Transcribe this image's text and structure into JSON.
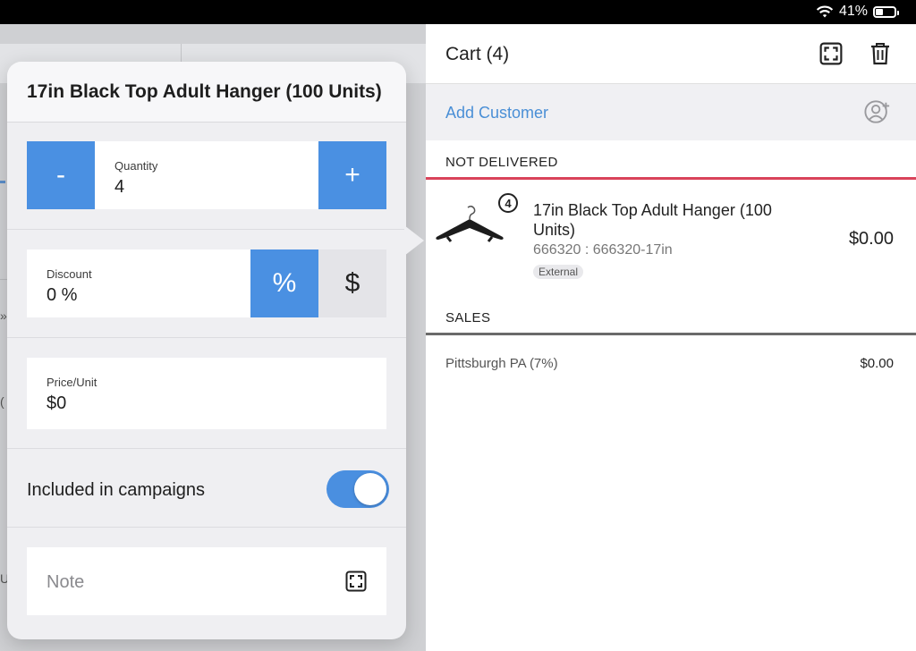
{
  "status_bar": {
    "battery_percent_label": "41%",
    "battery_level": 0.41
  },
  "background": {
    "glyph_1": "»",
    "glyph_2": "(",
    "glyph_3": "U"
  },
  "popover": {
    "title": "17in Black Top Adult Hanger (100 Units)",
    "quantity": {
      "label": "Quantity",
      "value": "4",
      "minus_label": "-",
      "plus_label": "+"
    },
    "discount": {
      "label": "Discount",
      "value": "0 %",
      "percent_label": "%",
      "dollar_label": "$"
    },
    "price_unit": {
      "label": "Price/Unit",
      "value": "$0"
    },
    "campaigns": {
      "label": "Included in campaigns",
      "enabled": true
    },
    "note": {
      "placeholder": "Note"
    }
  },
  "cart": {
    "title": "Cart (4)",
    "add_customer_label": "Add Customer",
    "sections": {
      "not_delivered": "NOT DELIVERED",
      "sales": "SALES"
    },
    "item": {
      "quantity": "4",
      "name": "17in Black Top Adult Hanger (100 Units)",
      "sku": "666320 : 666320-17in",
      "tag": "External",
      "price": "$0.00"
    },
    "tax": {
      "name": "Pittsburgh PA (7%)",
      "amount": "$0.00"
    }
  },
  "colors": {
    "accent_blue": "#4a90e2",
    "not_delivered_rule": "#d9435a",
    "link_blue": "#4a8fd6"
  }
}
